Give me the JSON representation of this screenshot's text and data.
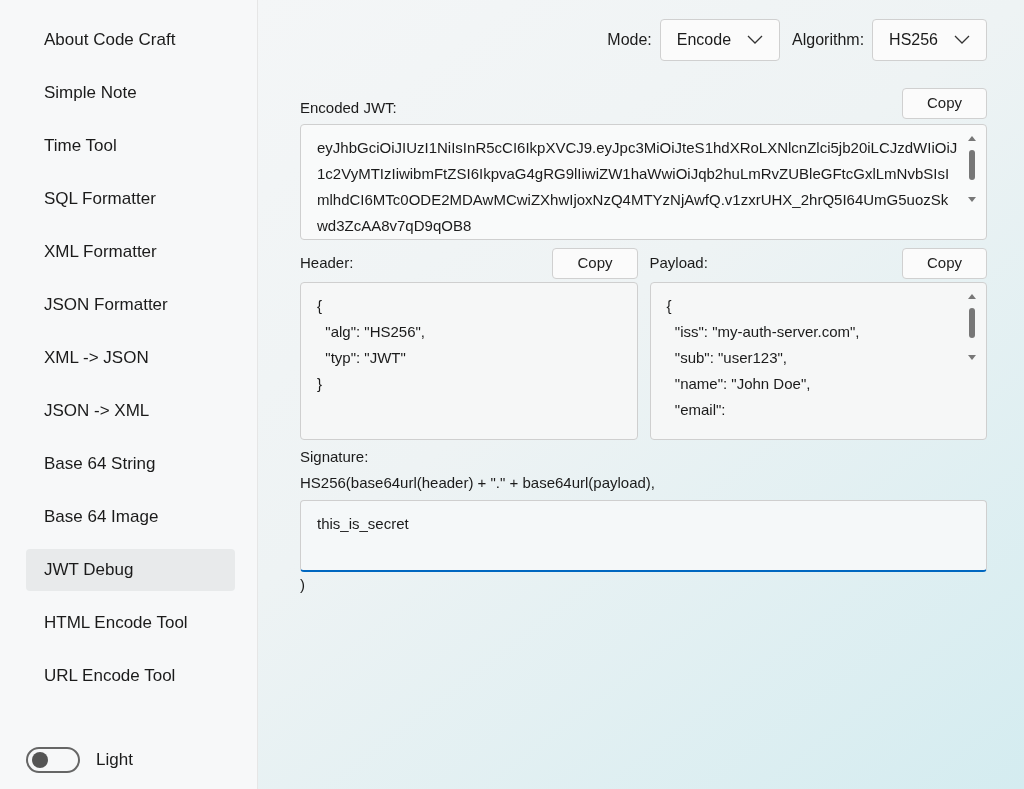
{
  "sidebar": {
    "items": [
      {
        "label": "About Code Craft",
        "selected": false
      },
      {
        "label": "Simple Note",
        "selected": false
      },
      {
        "label": "Time Tool",
        "selected": false
      },
      {
        "label": "SQL Formatter",
        "selected": false
      },
      {
        "label": "XML Formatter",
        "selected": false
      },
      {
        "label": "JSON Formatter",
        "selected": false
      },
      {
        "label": "XML -> JSON",
        "selected": false
      },
      {
        "label": "JSON -> XML",
        "selected": false
      },
      {
        "label": "Base 64 String",
        "selected": false
      },
      {
        "label": "Base 64 Image",
        "selected": false
      },
      {
        "label": "JWT Debug",
        "selected": true
      },
      {
        "label": "HTML Encode Tool",
        "selected": false
      },
      {
        "label": "URL Encode Tool",
        "selected": false
      }
    ],
    "theme_toggle": {
      "label": "Light",
      "on": false
    }
  },
  "toolbar": {
    "mode": {
      "label": "Mode:",
      "value": "Encode"
    },
    "algorithm": {
      "label": "Algorithm:",
      "value": "HS256"
    }
  },
  "encoded": {
    "label": "Encoded JWT:",
    "copy": "Copy",
    "value": "eyJhbGciOiJIUzI1NiIsInR5cCI6IkpXVCJ9.eyJpc3MiOiJteS1hdXRoLXNlcnZlci5jb20iLCJzdWIiOiJ1c2VyMTIzIiwibmFtZSI6IkpvaG4gRG9lIiwiZW1haWwiOiJqb2huLmRvZUBleGFtcGxlLmNvbSIsImlhdCI6MTc0ODE2MDAwMCwiZXhwIjoxNzQ4MTYzNjAwfQ.v1zxrUHX_2hrQ5I64UmG5uozSkwd3ZcAA8v7qD9qOB8"
  },
  "header": {
    "label": "Header:",
    "copy": "Copy",
    "lines": [
      "{",
      "  \"alg\": \"HS256\",",
      "  \"typ\": \"JWT\"",
      "}"
    ]
  },
  "payload": {
    "label": "Payload:",
    "copy": "Copy",
    "lines": [
      "{",
      "  \"iss\": \"my-auth-server.com\",",
      "  \"sub\": \"user123\",",
      "  \"name\": \"John Doe\",",
      "  \"email\":"
    ]
  },
  "signature": {
    "label": "Signature:",
    "formula": "HS256(base64url(header) + \".\" + base64url(payload),",
    "secret": "this_is_secret",
    "closing": ")"
  }
}
